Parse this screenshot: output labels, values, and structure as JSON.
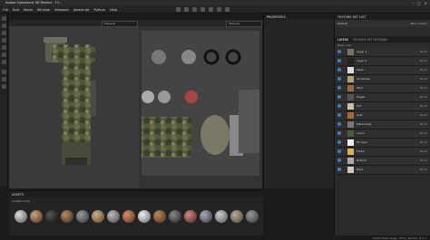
{
  "window": {
    "title": "Adobe Substance 3D Painter - F:/...",
    "controls": [
      "–",
      "□",
      "✕"
    ]
  },
  "menu": [
    "File",
    "Edit",
    "Mode",
    "Window",
    "Viewport",
    "Javascript",
    "Python",
    "Help"
  ],
  "viewport3d": {
    "material_select": "Material"
  },
  "viewport2d": {
    "material_select": "Material"
  },
  "properties": {
    "title": "PROPERTIES"
  },
  "texture_set_list": {
    "title": "TEXTURE SET LIST",
    "item": "Default",
    "shader_btn": "Main shader"
  },
  "layers": {
    "title": "LAYERS",
    "tab2": "TEXTURE SET SETTINGS",
    "blend_mode": "Base color",
    "items": [
      {
        "label": "Layer 1",
        "blend": "Norm"
      },
      {
        "label": "Layer 2",
        "blend": "Norm"
      },
      {
        "label": "Mask",
        "blend": "Norm"
      },
      {
        "label": "Scratches",
        "blend": "Norm"
      },
      {
        "label": "Paint",
        "blend": "Norm"
      },
      {
        "label": "Edges",
        "blend": "Norm"
      },
      {
        "label": "Dirt",
        "blend": "Norm"
      },
      {
        "label": "Rust",
        "blend": "Norm"
      },
      {
        "label": "Metal base",
        "blend": "Norm"
      },
      {
        "label": "Camo",
        "blend": "Norm"
      },
      {
        "label": "Fill layer",
        "blend": "Norm"
      },
      {
        "label": "Folder",
        "blend": "Norm"
      },
      {
        "label": "Bottom",
        "blend": "Norm"
      },
      {
        "label": "Base",
        "blend": "Norm"
      }
    ]
  },
  "shelf": {
    "title": "ASSETS",
    "filter": "All Resources",
    "search_placeholder": "Search..."
  },
  "status": {
    "text": "Cache Disk Usage: 70% | Version: 9.1.1"
  }
}
